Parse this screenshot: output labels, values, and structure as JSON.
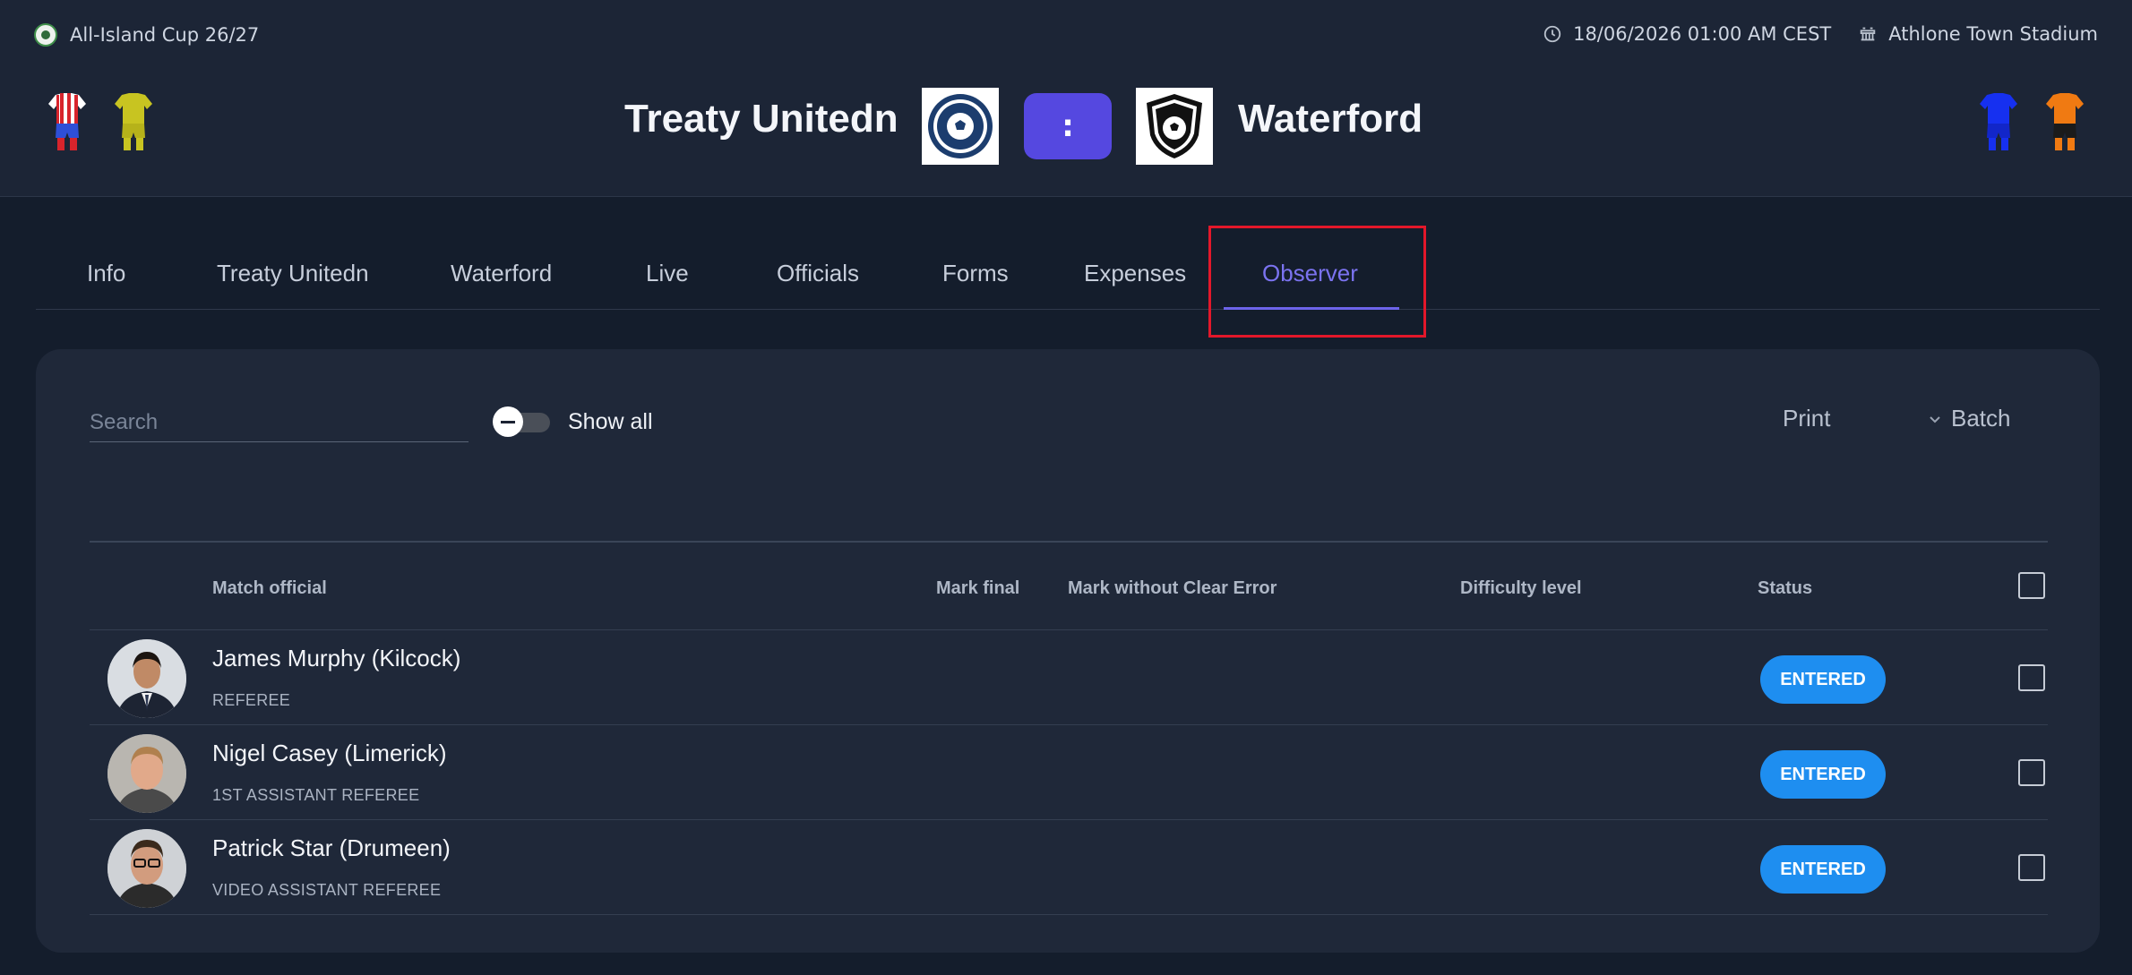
{
  "header": {
    "competition": "All-Island Cup 26/27",
    "datetime": "18/06/2026 01:00 AM CEST",
    "venue": "Athlone Town Stadium",
    "home_team": "Treaty Unitedn",
    "away_team": "Waterford",
    "score_separator": ":",
    "home_kits": [
      "home-red-white-striped-kit-icon",
      "home-yellow-kit-icon"
    ],
    "away_kits": [
      "away-blue-kit-icon",
      "away-orange-kit-icon"
    ]
  },
  "tabs": [
    {
      "label": "Info"
    },
    {
      "label": "Treaty Unitedn"
    },
    {
      "label": "Waterford"
    },
    {
      "label": "Live"
    },
    {
      "label": "Officials"
    },
    {
      "label": "Forms"
    },
    {
      "label": "Expenses"
    },
    {
      "label": "Observer",
      "active": true
    }
  ],
  "toolbar": {
    "search_placeholder": "Search",
    "show_all_label": "Show all",
    "print_label": "Print",
    "batch_label": "Batch"
  },
  "table": {
    "headers": {
      "official": "Match official",
      "mark_final": "Mark final",
      "mark_without": "Mark without Clear Error",
      "difficulty": "Difficulty level",
      "status": "Status"
    },
    "rows": [
      {
        "name": "James Murphy (Kilcock)",
        "role": "REFEREE",
        "status": "ENTERED"
      },
      {
        "name": "Nigel Casey (Limerick)",
        "role": "1ST ASSISTANT REFEREE",
        "status": "ENTERED"
      },
      {
        "name": "Patrick Star (Drumeen)",
        "role": "VIDEO ASSISTANT REFEREE",
        "status": "ENTERED"
      }
    ]
  },
  "colors": {
    "accent": "#6d64ea",
    "status_badge": "#1e8ef0",
    "highlight_box": "#e3172a"
  }
}
